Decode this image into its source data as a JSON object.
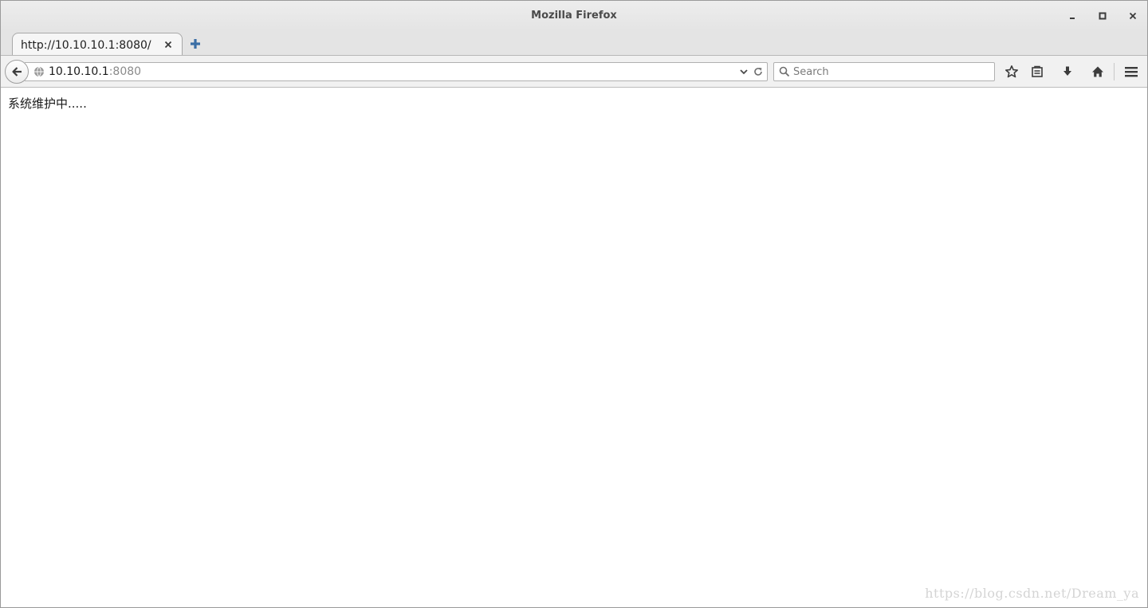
{
  "window": {
    "title": "Mozilla Firefox",
    "controls": [
      "minimize-icon",
      "maximize-icon",
      "close-icon"
    ]
  },
  "tabs": [
    {
      "label": "http://10.10.10.1:8080/",
      "active": true
    }
  ],
  "navbar": {
    "url_host": "10.10.10.1",
    "url_port": ":8080",
    "search_placeholder": "Search",
    "search_value": "",
    "icons": [
      "back-arrow-icon",
      "globe-icon",
      "dropdown-icon",
      "reload-icon",
      "search-icon",
      "bookmark-star-icon",
      "reading-list-icon",
      "download-icon",
      "home-icon",
      "hamburger-menu-icon"
    ]
  },
  "page": {
    "text": "系统维护中....."
  },
  "watermark": {
    "text": "https://blog.csdn.net/Dream_ya"
  },
  "colors": {
    "chrome_bg": "#e4e4e4",
    "navbar_bg": "#f1f1f1",
    "accent_plus": "#3a6ea5"
  }
}
